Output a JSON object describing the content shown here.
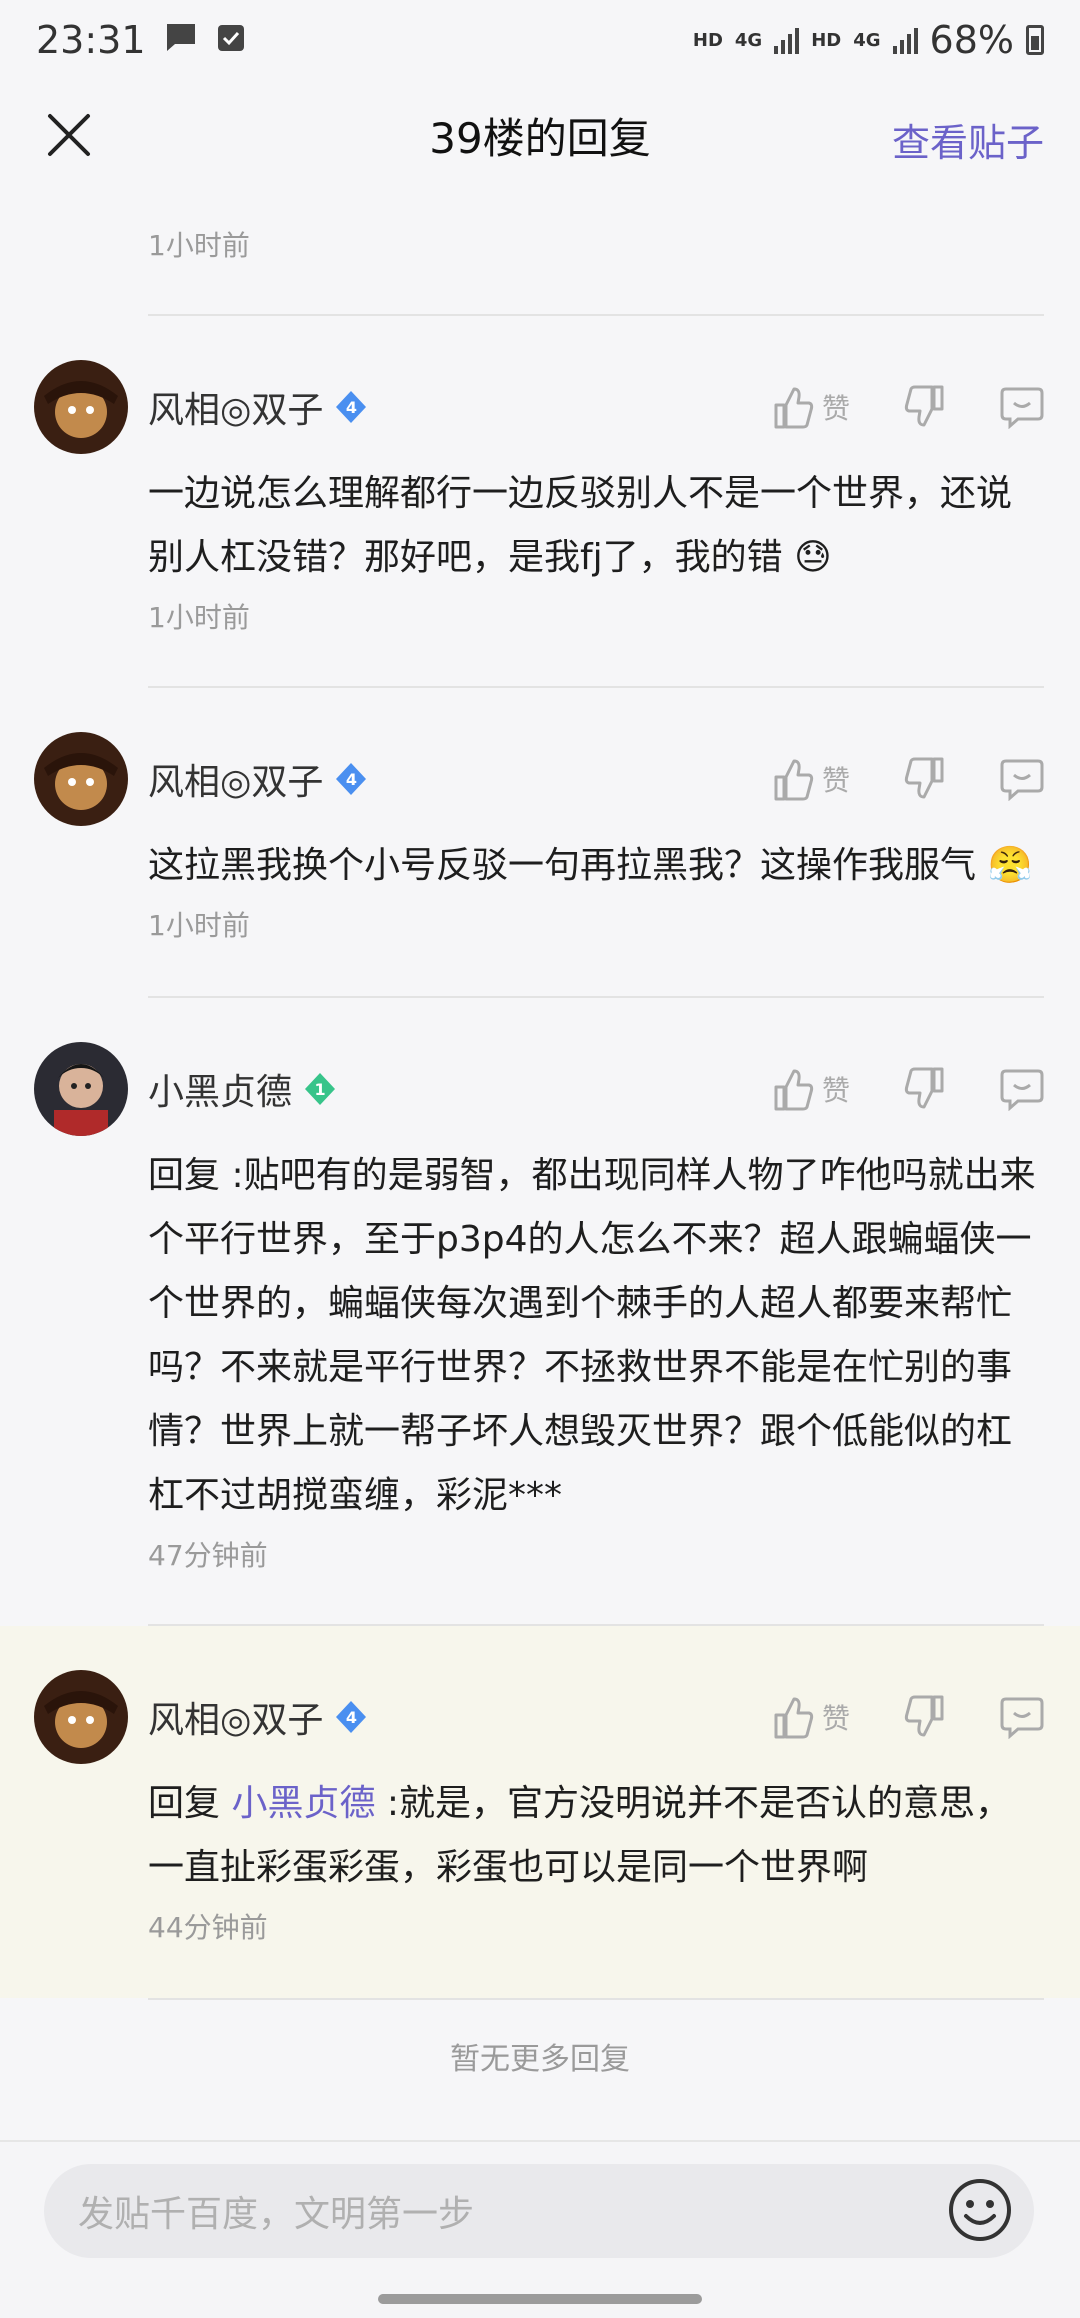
{
  "status_bar": {
    "time": "23:31",
    "hd1": "HD",
    "net1": "4G",
    "hd2": "HD",
    "net2": "4G",
    "battery": "68%"
  },
  "header": {
    "title": "39楼的回复",
    "view_post": "查看贴子"
  },
  "top_time": "1小时前",
  "like_label": "赞",
  "replies": [
    {
      "user": "风相◎双子",
      "level": "4",
      "text": "一边说怎么理解都行一边反驳别人不是一个世界，还说别人杠没错？那好吧，是我fj了，我的错",
      "emoji": "😓",
      "time": "1小时前"
    },
    {
      "user": "风相◎双子",
      "level": "4",
      "text": "这拉黑我换个小号反驳一句再拉黑我？这操作我服气",
      "emoji": "😤",
      "time": "1小时前"
    },
    {
      "user": "小黑贞德",
      "level": "1",
      "reply_prefix": "回复",
      "text": " :贴吧有的是弱智，都出现同样人物了咋他吗就出来个平行世界，至于p3p4的人怎么不来？超人跟蝙蝠侠一个世界的，蝙蝠侠每次遇到个棘手的人超人都要来帮忙吗？不来就是平行世界？不拯救世界不能是在忙别的事情？世界上就一帮子坏人想毁灭世界？跟个低能似的杠杠不过胡搅蛮缠，彩泥***",
      "time": "47分钟前"
    },
    {
      "user": "风相◎双子",
      "level": "4",
      "reply_prefix": "回复",
      "reply_to": "小黑贞德",
      "text": " :就是，官方没明说并不是否认的意思，一直扯彩蛋彩蛋，彩蛋也可以是同一个世界啊",
      "time": "44分钟前"
    }
  ],
  "no_more": "暂无更多回复",
  "input_placeholder": "发贴千百度，文明第一步",
  "colors": {
    "accent": "#6b62c9",
    "badge_blue": "#4a8ff0",
    "badge_green": "#37c48a",
    "highlight_bg": "#f7f6ec"
  }
}
